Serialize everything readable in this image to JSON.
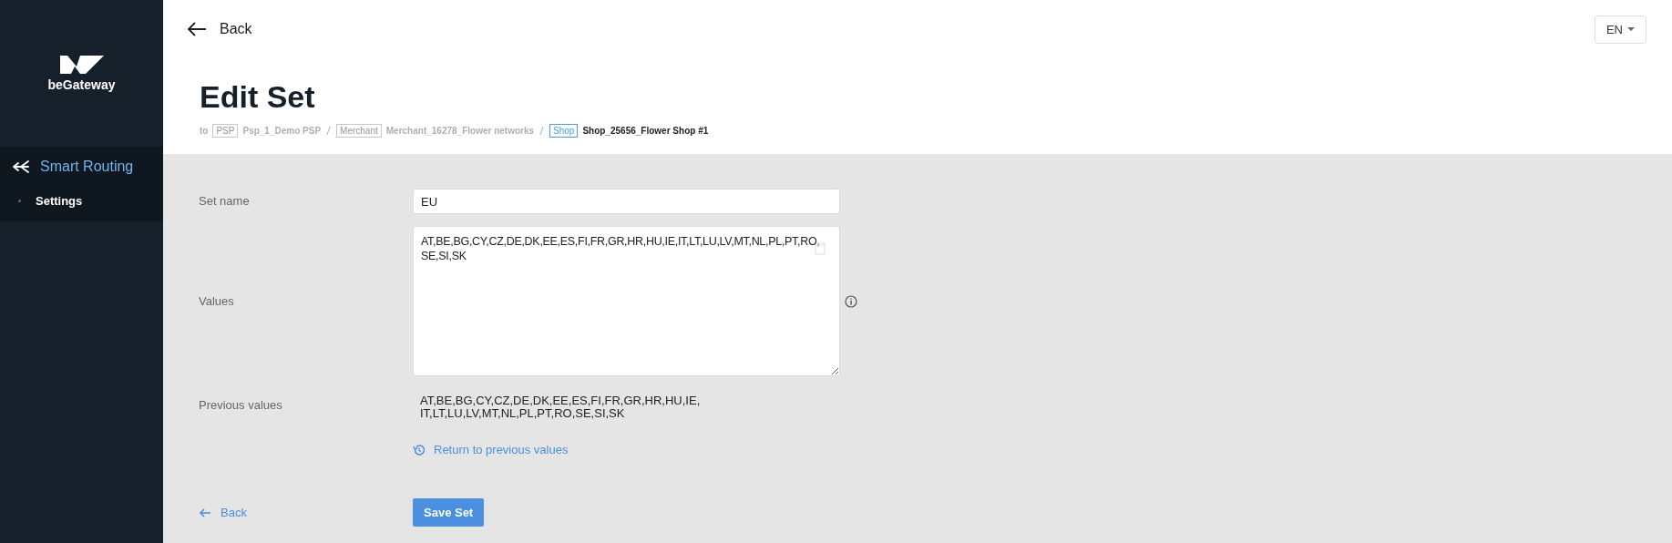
{
  "sidebar": {
    "logo_text": "beGateway",
    "items": [
      {
        "label": "Smart Routing",
        "expanded": true,
        "children": [
          {
            "label": "Settings",
            "selected": true
          }
        ]
      }
    ]
  },
  "header": {
    "back_label": "Back",
    "language": "EN",
    "title": "Edit Set",
    "breadcrumb_prefix": "to",
    "breadcrumb": [
      {
        "tag": "PSP",
        "name": "Psp_1_Demo PSP",
        "selected": false
      },
      {
        "tag": "Merchant",
        "name": "Merchant_16278_Flower networks",
        "selected": false
      },
      {
        "tag": "Shop",
        "name": "Shop_25656_Flower Shop #1",
        "selected": true
      }
    ]
  },
  "form": {
    "set_name_label": "Set name",
    "set_name_value": "EU",
    "values_label": "Values",
    "values_value": "AT,BE,BG,CY,CZ,DE,DK,EE,ES,FI,FR,GR,HR,HU,IE,IT,LT,LU,LV,MT,NL,PL,PT,RO,SE,SI,SK",
    "previous_label": "Previous values",
    "previous_lines": [
      "AT,BE,BG,CY,CZ,DE,DK,EE,ES,FI,FR,GR,HR,HU,IE,",
      "IT,LT,LU,LV,MT,NL,PL,PT,RO,SE,SI,SK"
    ],
    "return_link": "Return to previous values",
    "back_link": "Back",
    "save_button": "Save Set"
  }
}
